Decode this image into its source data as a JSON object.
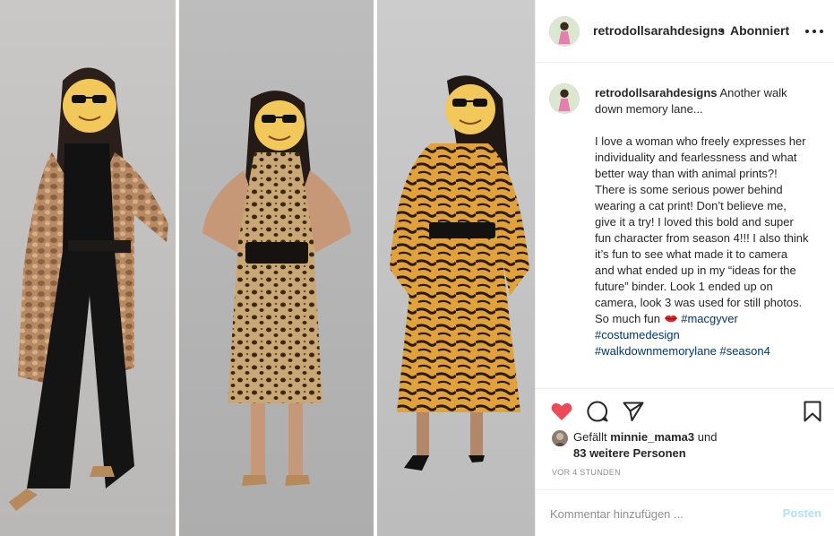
{
  "post": {
    "username": "retrodollsarahdesigns",
    "separator": "•",
    "follow_status": "Abonniert"
  },
  "caption": {
    "username": "retrodollsarahdesigns",
    "intro": "Another walk down memory lane...",
    "body": "I love a woman who freely expresses her individuality and fearlessness and what better way than with animal prints?! There is some serious power behind wearing a cat print! Don’t believe me, give it a try! I loved this bold and super fun character from season 4!!! I also think it’s fun to see what made it to camera and what ended up in my “ideas for the future” binder. Look 1 ended up on camera, look 3 was used for still photos. So much fun",
    "hashtags": [
      "#macgyver",
      "#costumedesign",
      "#walkdownmemorylane",
      "#season4"
    ]
  },
  "likes": {
    "prefix": "Gefällt",
    "user": "minnie_mama3",
    "conjunction": "und",
    "others": "83 weitere Personen"
  },
  "timestamp": "VOR 4 STUNDEN",
  "comment_box": {
    "placeholder": "Kommentar hinzufügen ...",
    "post_label": "Posten"
  },
  "icons": {
    "like": "heart-icon",
    "comment": "comment-icon",
    "share": "paper-plane-icon",
    "save": "bookmark-icon",
    "more": "more-options-icon"
  },
  "colors": {
    "like_red": "#ed4956",
    "link_blue": "#00376b",
    "post_button_disabled": "#b2dffc",
    "muted_text": "#8e8e8e",
    "background_gray": "#bebebe"
  }
}
